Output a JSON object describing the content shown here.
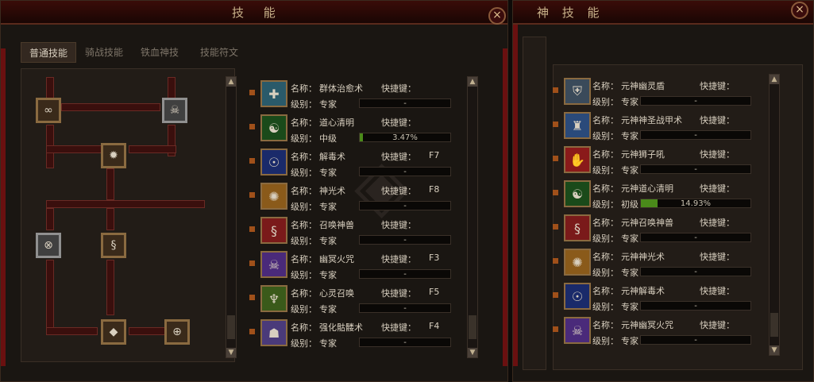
{
  "left_panel": {
    "title": "技 能",
    "close": "×",
    "tabs": [
      "普通技能",
      "骑战技能",
      "铁血神技",
      "技能符文"
    ],
    "skills": [
      {
        "name_label": "名称：",
        "name": "群体治愈术",
        "hotkey_label": "快捷键：",
        "hotkey": "",
        "level_label": "级别：",
        "level": "专家",
        "progress_text": "-",
        "progress": 0,
        "icon": "heal-icon",
        "icon_color": "#2a5a6a"
      },
      {
        "name_label": "名称：",
        "name": "道心清明",
        "hotkey_label": "快捷键：",
        "hotkey": "",
        "level_label": "级别：",
        "level": "中级",
        "progress_text": "3.47%",
        "progress": 3.47,
        "icon": "yin-yang-icon",
        "icon_color": "#1a4a1a"
      },
      {
        "name_label": "名称：",
        "name": "解毒术",
        "hotkey_label": "快捷键：",
        "hotkey": "F7",
        "level_label": "级别：",
        "level": "专家",
        "progress_text": "-",
        "progress": 0,
        "icon": "meditate-icon",
        "icon_color": "#1a2a6a"
      },
      {
        "name_label": "名称：",
        "name": "神光术",
        "hotkey_label": "快捷键：",
        "hotkey": "F8",
        "level_label": "级别：",
        "level": "专家",
        "progress_text": "-",
        "progress": 0,
        "icon": "light-icon",
        "icon_color": "#8a5a1a"
      },
      {
        "name_label": "名称：",
        "name": "召唤神兽",
        "hotkey_label": "快捷键：",
        "hotkey": "",
        "level_label": "级别：",
        "level": "专家",
        "progress_text": "-",
        "progress": 0,
        "icon": "dragon-icon",
        "icon_color": "#7a1a1a"
      },
      {
        "name_label": "名称：",
        "name": "幽冥火咒",
        "hotkey_label": "快捷键：",
        "hotkey": "F3",
        "level_label": "级别：",
        "level": "专家",
        "progress_text": "-",
        "progress": 0,
        "icon": "skull-icon",
        "icon_color": "#4a2a7a"
      },
      {
        "name_label": "名称：",
        "name": "心灵召唤",
        "hotkey_label": "快捷键：",
        "hotkey": "F5",
        "level_label": "级别：",
        "level": "专家",
        "progress_text": "-",
        "progress": 0,
        "icon": "summon-icon",
        "icon_color": "#3a5a1a"
      },
      {
        "name_label": "名称：",
        "name": "强化骷髅术",
        "hotkey_label": "快捷键：",
        "hotkey": "F4",
        "level_label": "级别：",
        "level": "专家",
        "progress_text": "-",
        "progress": 0,
        "icon": "skeleton-icon",
        "icon_color": "#4a3a7a"
      }
    ]
  },
  "right_panel": {
    "title": "神 技 能",
    "close": "×",
    "skills": [
      {
        "name_label": "名称：",
        "name": "元神幽灵盾",
        "hotkey_label": "快捷键：",
        "level_label": "级别：",
        "level": "专家",
        "progress_text": "-",
        "progress": 0,
        "icon": "shield-icon",
        "icon_color": "#3a4a5a"
      },
      {
        "name_label": "名称：",
        "name": "元神神圣战甲术",
        "hotkey_label": "快捷键：",
        "level_label": "级别：",
        "level": "专家",
        "progress_text": "-",
        "progress": 0,
        "icon": "armor-icon",
        "icon_color": "#2a4a7a"
      },
      {
        "name_label": "名称：",
        "name": "元神狮子吼",
        "hotkey_label": "快捷键：",
        "level_label": "级别：",
        "level": "专家",
        "progress_text": "-",
        "progress": 0,
        "icon": "roar-icon",
        "icon_color": "#8a1a1a"
      },
      {
        "name_label": "名称：",
        "name": "元神道心清明",
        "hotkey_label": "快捷键：",
        "level_label": "级别：",
        "level": "初级",
        "progress_text": "14.93%",
        "progress": 14.93,
        "icon": "yin-yang-icon",
        "icon_color": "#1a4a1a"
      },
      {
        "name_label": "名称：",
        "name": "元神召唤神兽",
        "hotkey_label": "快捷键：",
        "level_label": "级别：",
        "level": "专家",
        "progress_text": "-",
        "progress": 0,
        "icon": "dragon-icon",
        "icon_color": "#7a1a1a"
      },
      {
        "name_label": "名称：",
        "name": "元神神光术",
        "hotkey_label": "快捷键：",
        "level_label": "级别：",
        "level": "专家",
        "progress_text": "-",
        "progress": 0,
        "icon": "light-icon",
        "icon_color": "#8a5a1a"
      },
      {
        "name_label": "名称：",
        "name": "元神解毒术",
        "hotkey_label": "快捷键：",
        "level_label": "级别：",
        "level": "专家",
        "progress_text": "-",
        "progress": 0,
        "icon": "meditate-icon",
        "icon_color": "#1a2a6a"
      },
      {
        "name_label": "名称：",
        "name": "元神幽冥火咒",
        "hotkey_label": "快捷键：",
        "level_label": "级别：",
        "level": "专家",
        "progress_text": "-",
        "progress": 0,
        "icon": "skull-icon",
        "icon_color": "#4a2a7a"
      }
    ]
  },
  "tree_nodes": [
    {
      "icon": "infinity-icon",
      "glyph": "∞",
      "color": "#5a3a2a"
    },
    {
      "icon": "skull-icon",
      "glyph": "☠",
      "color": "#404040"
    },
    {
      "icon": "fire-icon",
      "glyph": "✹",
      "color": "#8a2a1a"
    },
    {
      "icon": "seal-icon",
      "glyph": "⊗",
      "color": "#404040"
    },
    {
      "icon": "dragon-icon",
      "glyph": "§",
      "color": "#2a5a7a"
    },
    {
      "icon": "orb-icon",
      "glyph": "◆",
      "color": "#4a3a7a"
    },
    {
      "icon": "target-icon",
      "glyph": "⊕",
      "color": "#8a3a1a"
    }
  ],
  "scroll": {
    "up": "▲",
    "down": "▼"
  }
}
